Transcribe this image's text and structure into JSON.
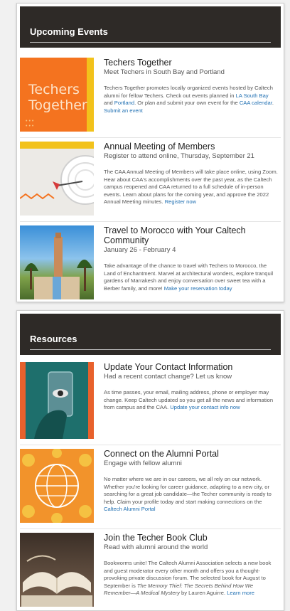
{
  "events": {
    "header": "Upcoming Events",
    "items": [
      {
        "title": "Techers Together",
        "subtitle": "Meet Techers in South Bay and Portland",
        "body_1": "Techers Together promotes locally organized events hosted by Caltech alumni for fellow Techers. Check out events planned in ",
        "link_1": "LA South Bay",
        "body_2": " and ",
        "link_2": "Portland",
        "body_3": ". Or plan and submit your own event for the ",
        "link_3": "CAA calendar",
        "body_4": ". ",
        "link_4": "Submit an event",
        "image_text_1": "Techers",
        "image_text_2": "Together"
      },
      {
        "title": "Annual Meeting of Members",
        "subtitle": "Register to attend online, Thursday, September 21",
        "body_1": "The CAA Annual Meeting of Members will take place online, using Zoom. Hear about CAA's accomplishments over the past year, as the Caltech campus reopened and CAA returned to a full schedule of in-person events. Learn about plans for the coming year, and approve the 2022 Annual Meeting minutes. ",
        "link_1": "Register now"
      },
      {
        "title": "Travel to Morocco with Your Caltech Community",
        "subtitle": "January 26 - February 4",
        "body_1": "Take advantage of the chance to travel with Techers to Morocco, the Land of Enchantment. Marvel at architectural wonders, explore tranquil gardens of Marrakesh and enjoy conversation over sweet tea with a Berber family, and more! ",
        "link_1": "Make your reservation today"
      }
    ]
  },
  "resources": {
    "header": "Resources",
    "items": [
      {
        "title": "Update Your Contact Information",
        "subtitle": "Had a recent contact change? Let us know",
        "body_1": "As time passes, your email, mailing address, phone or employer may change. Keep Caltech updated so you get all the news and information from campus and the CAA. ",
        "link_1": "Update your contact info now"
      },
      {
        "title": "Connect on the Alumni Portal",
        "subtitle": "Engage with fellow alumni",
        "body_1": "No matter where we are in our careers, we all rely on our network. Whether you're looking for career guidance, adapting to a new city, or searching for a great job candidate—the Techer community is ready to help. Claim your profile today and start making connections on the ",
        "link_1": "Caltech Alumni Portal"
      },
      {
        "title": "Join the Techer Book Club",
        "subtitle": "Read with alumni around the world",
        "body_1": "Bookworms unite! The Caltech Alumni Association selects a new book and guest moderator every other month and offers you a thought-provoking private discussion forum. The selected book for August to September is ",
        "italic_1": "The Memory Thief: The Secrets Behind How We Remember—A Medical Mystery",
        "body_2": " by Lauren Aguirre. ",
        "link_1": "Learn more"
      }
    ]
  }
}
